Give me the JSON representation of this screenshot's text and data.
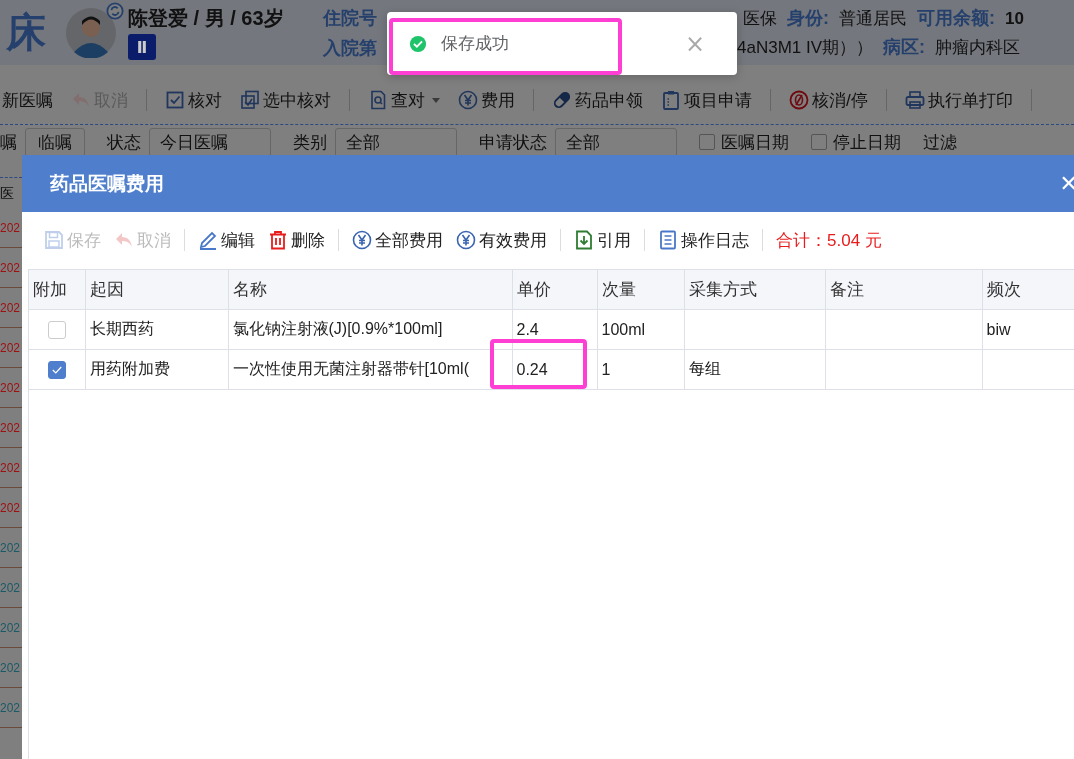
{
  "header": {
    "bed": "床",
    "name": "陈登爱 / 男 / 63岁",
    "badge": "Ⅱ",
    "left_labels": [
      "住院号",
      "入院第"
    ],
    "line1": [
      {
        "value": "医保"
      },
      {
        "label": "身份:",
        "value": "普通居民"
      },
      {
        "label": "可用余额:",
        "value": "10"
      }
    ],
    "line2": [
      {
        "value": "4aN3M1 IV期））"
      },
      {
        "label": "病区:",
        "value": "肿瘤内科区"
      }
    ]
  },
  "toolbar": [
    {
      "kind": "button",
      "label": "新医嘱",
      "disabled": false
    },
    {
      "kind": "button",
      "label": "取消",
      "disabled": true
    },
    {
      "kind": "separator"
    },
    {
      "kind": "button",
      "label": "核对",
      "disabled": false
    },
    {
      "kind": "button",
      "label": "选中核对",
      "disabled": false
    },
    {
      "kind": "separator"
    },
    {
      "kind": "button",
      "label": "查对",
      "disabled": false,
      "dropdown": true
    },
    {
      "kind": "button",
      "label": "费用",
      "disabled": false
    },
    {
      "kind": "separator"
    },
    {
      "kind": "button",
      "label": "药品申领",
      "disabled": false
    },
    {
      "kind": "button",
      "label": "项目申请",
      "disabled": false
    },
    {
      "kind": "separator"
    },
    {
      "kind": "button",
      "label": "核消/停",
      "disabled": false
    },
    {
      "kind": "separator"
    },
    {
      "kind": "button",
      "label": "执行单打印",
      "disabled": false
    },
    {
      "kind": "separator"
    }
  ],
  "filters": [
    {
      "kind": "text",
      "label": "嘱"
    },
    {
      "kind": "box",
      "label": "临嘱"
    },
    {
      "kind": "text",
      "label": "状态"
    },
    {
      "kind": "select",
      "value": "今日医嘱"
    },
    {
      "kind": "text",
      "label": "类别"
    },
    {
      "kind": "select",
      "value": "全部"
    },
    {
      "kind": "text",
      "label": "申请状态"
    },
    {
      "kind": "select",
      "value": "全部"
    },
    {
      "kind": "checkbox",
      "label": "医嘱日期",
      "checked": false
    },
    {
      "kind": "checkbox",
      "label": "停止日期",
      "checked": false
    },
    {
      "kind": "filter",
      "label": "过滤"
    }
  ],
  "order_list": {
    "heading": "医",
    "rows": [
      {
        "text": "202",
        "color": "#a01010"
      },
      {
        "text": "202",
        "color": "#a01010"
      },
      {
        "text": "202",
        "color": "#a01010"
      },
      {
        "text": "202",
        "color": "#a01010"
      },
      {
        "text": "202",
        "color": "#a01010"
      },
      {
        "text": "202",
        "color": "#a01010"
      },
      {
        "text": "202",
        "color": "#a01010"
      },
      {
        "text": "202",
        "color": "#a01010"
      },
      {
        "text": "202",
        "color": "#1a5a68"
      },
      {
        "text": "202",
        "color": "#1a5a68"
      },
      {
        "text": "202",
        "color": "#1a5a68"
      },
      {
        "text": "202",
        "color": "#1a5a68"
      },
      {
        "text": "202",
        "color": "#1a5a68"
      }
    ]
  },
  "dialog": {
    "title": "药品医嘱费用",
    "close": "✕",
    "toolbar": [
      {
        "kind": "button",
        "label": "保存",
        "disabled": true
      },
      {
        "kind": "button",
        "label": "取消",
        "disabled": true
      },
      {
        "kind": "separator"
      },
      {
        "kind": "button",
        "label": "编辑",
        "disabled": false
      },
      {
        "kind": "button",
        "label": "删除",
        "disabled": false
      },
      {
        "kind": "separator"
      },
      {
        "kind": "button",
        "label": "全部费用",
        "disabled": false
      },
      {
        "kind": "button",
        "label": "有效费用",
        "disabled": false
      },
      {
        "kind": "separator"
      },
      {
        "kind": "button",
        "label": "引用",
        "disabled": false
      },
      {
        "kind": "separator"
      },
      {
        "kind": "button",
        "label": "操作日志",
        "disabled": false
      },
      {
        "kind": "separator"
      },
      {
        "kind": "total",
        "label": "合计：5.04 元"
      }
    ],
    "table": {
      "columns": [
        "附加",
        "起因",
        "名称",
        "单价",
        "次量",
        "采集方式",
        "备注",
        "频次"
      ],
      "rows": [
        {
          "checked": false,
          "cells": [
            "",
            "长期西药",
            "氯化钠注射液(J)[0.9%*100ml]",
            "2.4",
            "100ml",
            "",
            "",
            "biw"
          ]
        },
        {
          "checked": true,
          "cells": [
            "",
            "用药附加费",
            "一次性使用无菌注射器带针[10ml(",
            "0.24",
            "1",
            "每组",
            "",
            ""
          ]
        }
      ]
    }
  },
  "toast": {
    "kind": "success",
    "text": "保存成功",
    "close": "×"
  }
}
